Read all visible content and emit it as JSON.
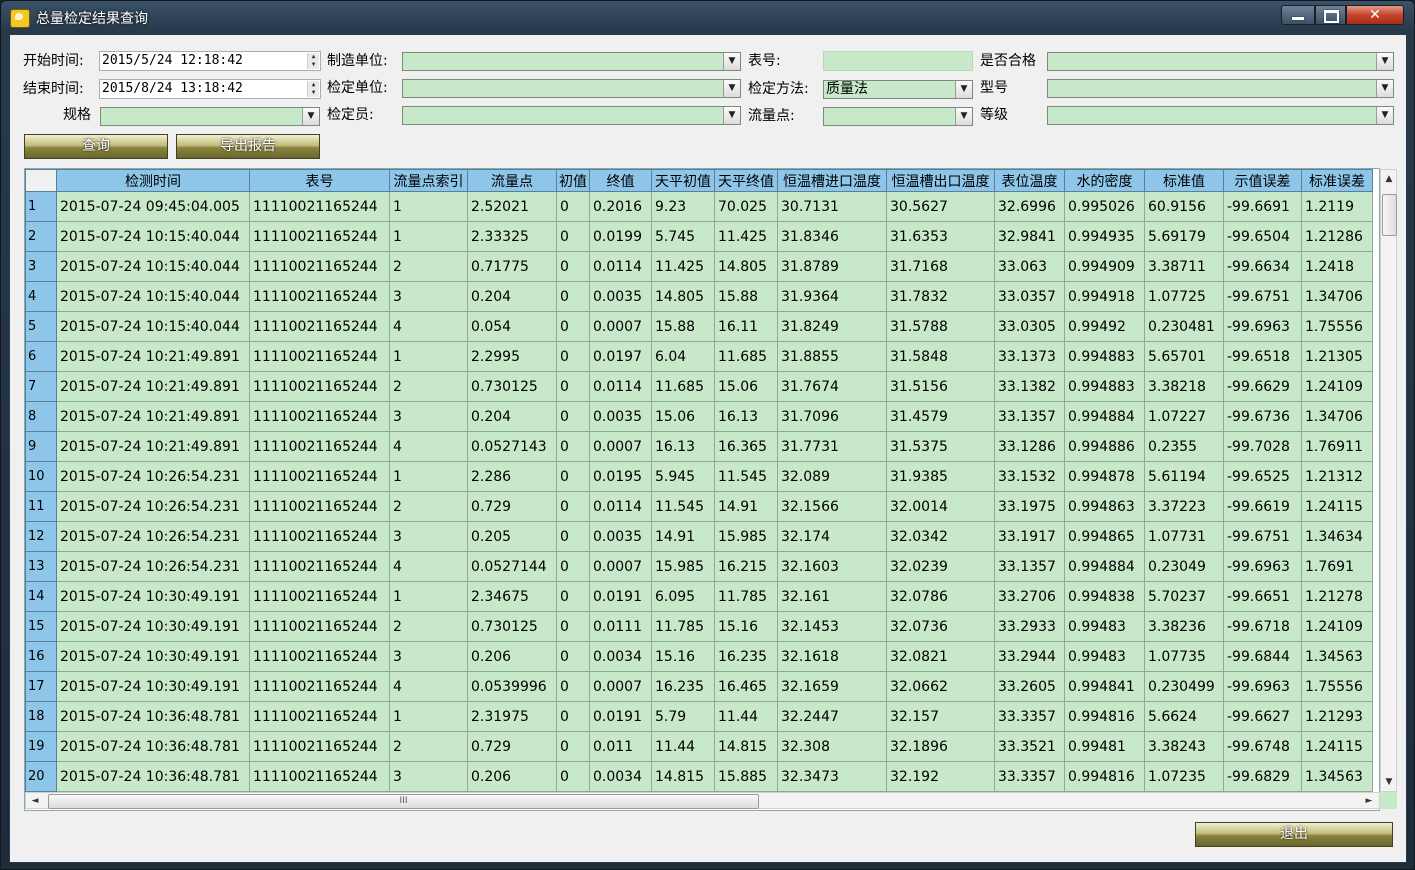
{
  "window": {
    "title": "总量检定结果查询",
    "minimize": "",
    "maximize": "",
    "close": "✕"
  },
  "filters": {
    "start_time": {
      "label": "开始时间:",
      "value": "2015/5/24 12:18:42"
    },
    "end_time": {
      "label": "结束时间:",
      "value": "2015/8/24 13:18:42"
    },
    "spec": {
      "label": "规格",
      "value": ""
    },
    "manufacturer": {
      "label": "制造单位:",
      "value": ""
    },
    "verify_unit": {
      "label": "检定单位:",
      "value": ""
    },
    "verifier": {
      "label": "检定员:",
      "value": ""
    },
    "meter_no": {
      "label": "表号:",
      "value": ""
    },
    "verify_method": {
      "label": "检定方法:",
      "value": "质量法"
    },
    "flow_point": {
      "label": "流量点:",
      "value": ""
    },
    "qualified": {
      "label": "是否合格",
      "value": ""
    },
    "model": {
      "label": "型号",
      "value": ""
    },
    "grade": {
      "label": "等级",
      "value": ""
    }
  },
  "buttons": {
    "query": "查询",
    "export": "导出报告",
    "exit": "退出"
  },
  "grid": {
    "columns": [
      "检测时间",
      "表号",
      "流量点索引",
      "流量点",
      "初值",
      "终值",
      "天平初值",
      "天平终值",
      "恒温槽进口温度",
      "恒温槽出口温度",
      "表位温度",
      "水的密度",
      "标准值",
      "示值误差",
      "标准误差"
    ],
    "rows": [
      [
        "1",
        "2015-07-24 09:45:04.005",
        "11110021165244",
        "1",
        "2.52021",
        "0",
        "0.2016",
        "9.23",
        "70.025",
        "30.7131",
        "30.5627",
        "32.6996",
        "0.995026",
        "60.9156",
        "-99.6691",
        "1.2119"
      ],
      [
        "2",
        "2015-07-24 10:15:40.044",
        "11110021165244",
        "1",
        "2.33325",
        "0",
        "0.0199",
        "5.745",
        "11.425",
        "31.8346",
        "31.6353",
        "32.9841",
        "0.994935",
        "5.69179",
        "-99.6504",
        "1.21286"
      ],
      [
        "3",
        "2015-07-24 10:15:40.044",
        "11110021165244",
        "2",
        "0.71775",
        "0",
        "0.0114",
        "11.425",
        "14.805",
        "31.8789",
        "31.7168",
        "33.063",
        "0.994909",
        "3.38711",
        "-99.6634",
        "1.2418"
      ],
      [
        "4",
        "2015-07-24 10:15:40.044",
        "11110021165244",
        "3",
        "0.204",
        "0",
        "0.0035",
        "14.805",
        "15.88",
        "31.9364",
        "31.7832",
        "33.0357",
        "0.994918",
        "1.07725",
        "-99.6751",
        "1.34706"
      ],
      [
        "5",
        "2015-07-24 10:15:40.044",
        "11110021165244",
        "4",
        "0.054",
        "0",
        "0.0007",
        "15.88",
        "16.11",
        "31.8249",
        "31.5788",
        "33.0305",
        "0.99492",
        "0.230481",
        "-99.6963",
        "1.75556"
      ],
      [
        "6",
        "2015-07-24 10:21:49.891",
        "11110021165244",
        "1",
        "2.2995",
        "0",
        "0.0197",
        "6.04",
        "11.685",
        "31.8855",
        "31.5848",
        "33.1373",
        "0.994883",
        "5.65701",
        "-99.6518",
        "1.21305"
      ],
      [
        "7",
        "2015-07-24 10:21:49.891",
        "11110021165244",
        "2",
        "0.730125",
        "0",
        "0.0114",
        "11.685",
        "15.06",
        "31.7674",
        "31.5156",
        "33.1382",
        "0.994883",
        "3.38218",
        "-99.6629",
        "1.24109"
      ],
      [
        "8",
        "2015-07-24 10:21:49.891",
        "11110021165244",
        "3",
        "0.204",
        "0",
        "0.0035",
        "15.06",
        "16.13",
        "31.7096",
        "31.4579",
        "33.1357",
        "0.994884",
        "1.07227",
        "-99.6736",
        "1.34706"
      ],
      [
        "9",
        "2015-07-24 10:21:49.891",
        "11110021165244",
        "4",
        "0.0527143",
        "0",
        "0.0007",
        "16.13",
        "16.365",
        "31.7731",
        "31.5375",
        "33.1286",
        "0.994886",
        "0.2355",
        "-99.7028",
        "1.76911"
      ],
      [
        "10",
        "2015-07-24 10:26:54.231",
        "11110021165244",
        "1",
        "2.286",
        "0",
        "0.0195",
        "5.945",
        "11.545",
        "32.089",
        "31.9385",
        "33.1532",
        "0.994878",
        "5.61194",
        "-99.6525",
        "1.21312"
      ],
      [
        "11",
        "2015-07-24 10:26:54.231",
        "11110021165244",
        "2",
        "0.729",
        "0",
        "0.0114",
        "11.545",
        "14.91",
        "32.1566",
        "32.0014",
        "33.1975",
        "0.994863",
        "3.37223",
        "-99.6619",
        "1.24115"
      ],
      [
        "12",
        "2015-07-24 10:26:54.231",
        "11110021165244",
        "3",
        "0.205",
        "0",
        "0.0035",
        "14.91",
        "15.985",
        "32.174",
        "32.0342",
        "33.1917",
        "0.994865",
        "1.07731",
        "-99.6751",
        "1.34634"
      ],
      [
        "13",
        "2015-07-24 10:26:54.231",
        "11110021165244",
        "4",
        "0.0527144",
        "0",
        "0.0007",
        "15.985",
        "16.215",
        "32.1603",
        "32.0239",
        "33.1357",
        "0.994884",
        "0.23049",
        "-99.6963",
        "1.7691"
      ],
      [
        "14",
        "2015-07-24 10:30:49.191",
        "11110021165244",
        "1",
        "2.34675",
        "0",
        "0.0191",
        "6.095",
        "11.785",
        "32.161",
        "32.0786",
        "33.2706",
        "0.994838",
        "5.70237",
        "-99.6651",
        "1.21278"
      ],
      [
        "15",
        "2015-07-24 10:30:49.191",
        "11110021165244",
        "2",
        "0.730125",
        "0",
        "0.0111",
        "11.785",
        "15.16",
        "32.1453",
        "32.0736",
        "33.2933",
        "0.99483",
        "3.38236",
        "-99.6718",
        "1.24109"
      ],
      [
        "16",
        "2015-07-24 10:30:49.191",
        "11110021165244",
        "3",
        "0.206",
        "0",
        "0.0034",
        "15.16",
        "16.235",
        "32.1618",
        "32.0821",
        "33.2944",
        "0.99483",
        "1.07735",
        "-99.6844",
        "1.34563"
      ],
      [
        "17",
        "2015-07-24 10:30:49.191",
        "11110021165244",
        "4",
        "0.0539996",
        "0",
        "0.0007",
        "16.235",
        "16.465",
        "32.1659",
        "32.0662",
        "33.2605",
        "0.994841",
        "0.230499",
        "-99.6963",
        "1.75556"
      ],
      [
        "18",
        "2015-07-24 10:36:48.781",
        "11110021165244",
        "1",
        "2.31975",
        "0",
        "0.0191",
        "5.79",
        "11.44",
        "32.2447",
        "32.157",
        "33.3357",
        "0.994816",
        "5.6624",
        "-99.6627",
        "1.21293"
      ],
      [
        "19",
        "2015-07-24 10:36:48.781",
        "11110021165244",
        "2",
        "0.729",
        "0",
        "0.011",
        "11.44",
        "14.815",
        "32.308",
        "32.1896",
        "33.3521",
        "0.99481",
        "3.38243",
        "-99.6748",
        "1.24115"
      ],
      [
        "20",
        "2015-07-24 10:36:48.781",
        "11110021165244",
        "3",
        "0.206",
        "0",
        "0.0034",
        "14.815",
        "15.885",
        "32.3473",
        "32.192",
        "33.3357",
        "0.994816",
        "1.07235",
        "-99.6829",
        "1.34563"
      ]
    ]
  },
  "scrollbar": {
    "grip": "III"
  }
}
